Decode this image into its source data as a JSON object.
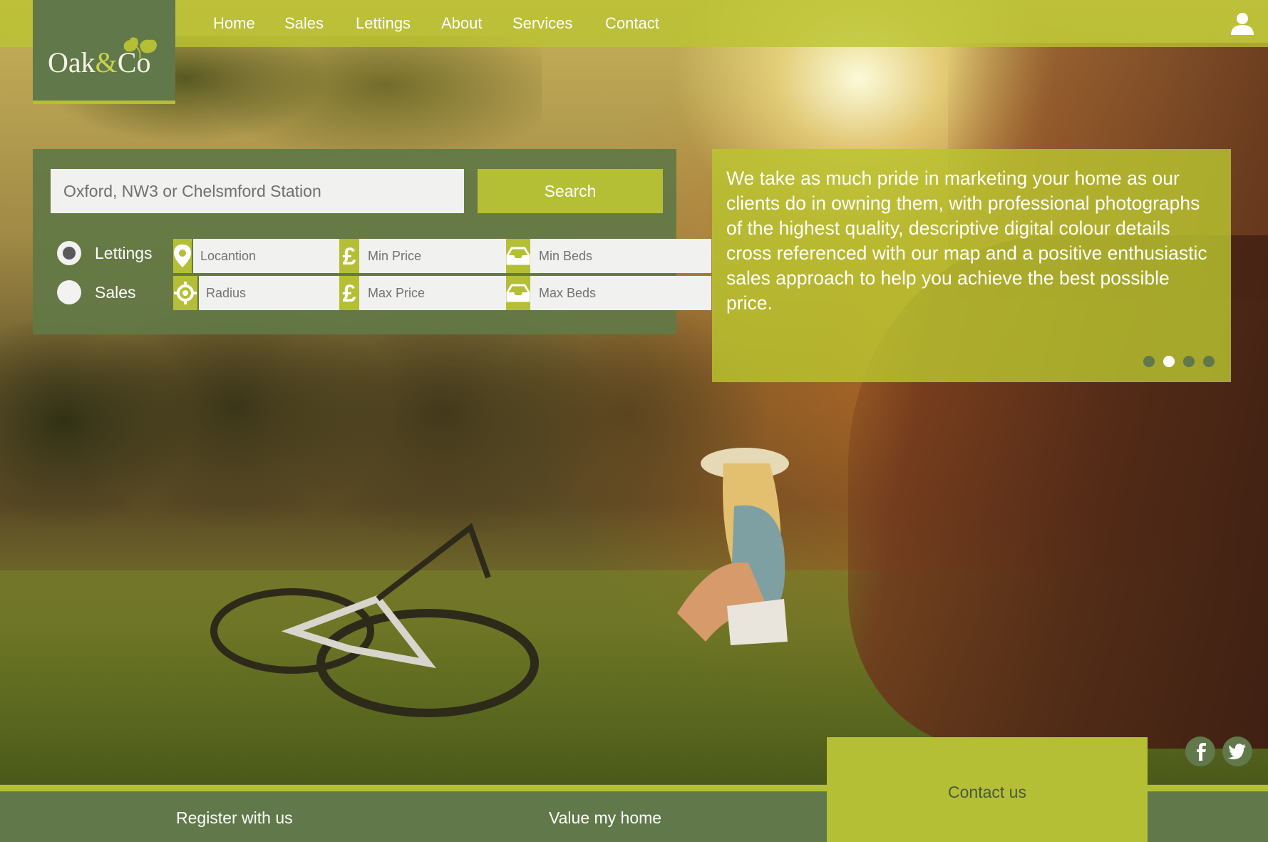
{
  "brand": {
    "name_part1": "Oak",
    "name_amp": "&",
    "name_part2": "Co"
  },
  "nav": {
    "items": [
      {
        "label": "Home"
      },
      {
        "label": "Sales"
      },
      {
        "label": "Lettings"
      },
      {
        "label": "About"
      },
      {
        "label": "Services"
      },
      {
        "label": "Contact"
      }
    ],
    "user_icon": "user-icon"
  },
  "search": {
    "placeholder": "Oxford, NW3 or Chelsmford Station",
    "button_label": "Search",
    "mode": {
      "options": [
        {
          "label": "Lettings",
          "checked": true
        },
        {
          "label": "Sales",
          "checked": false
        }
      ]
    },
    "filters": {
      "location": {
        "placeholder": "Locantion",
        "icon": "map-pin-icon"
      },
      "radius": {
        "placeholder": "Radius",
        "icon": "crosshair-icon"
      },
      "min_price": {
        "placeholder": "Min Price",
        "icon": "pound-icon"
      },
      "max_price": {
        "placeholder": "Max Price",
        "icon": "pound-icon"
      },
      "min_beds": {
        "placeholder": "Min Beds",
        "icon": "bed-icon"
      },
      "max_beds": {
        "placeholder": "Max Beds",
        "icon": "bed-icon"
      }
    }
  },
  "quote": {
    "text": "We take as much pride in marketing your home as our clients do in owning them, with professional photographs of the highest quality, descriptive digital colour details cross referenced with our map and a positive enthusiastic sales approach to help you achieve the best possible price.",
    "slides_total": 4,
    "active_slide": 2
  },
  "social": {
    "facebook_icon": "facebook-icon",
    "twitter_icon": "twitter-icon"
  },
  "footer": {
    "register_label": "Register with us",
    "value_label": "Value my home",
    "contact_label": "Contact us"
  },
  "colors": {
    "accent_green": "#b4bf36",
    "dark_green": "#61784a",
    "white": "#ffffff"
  }
}
